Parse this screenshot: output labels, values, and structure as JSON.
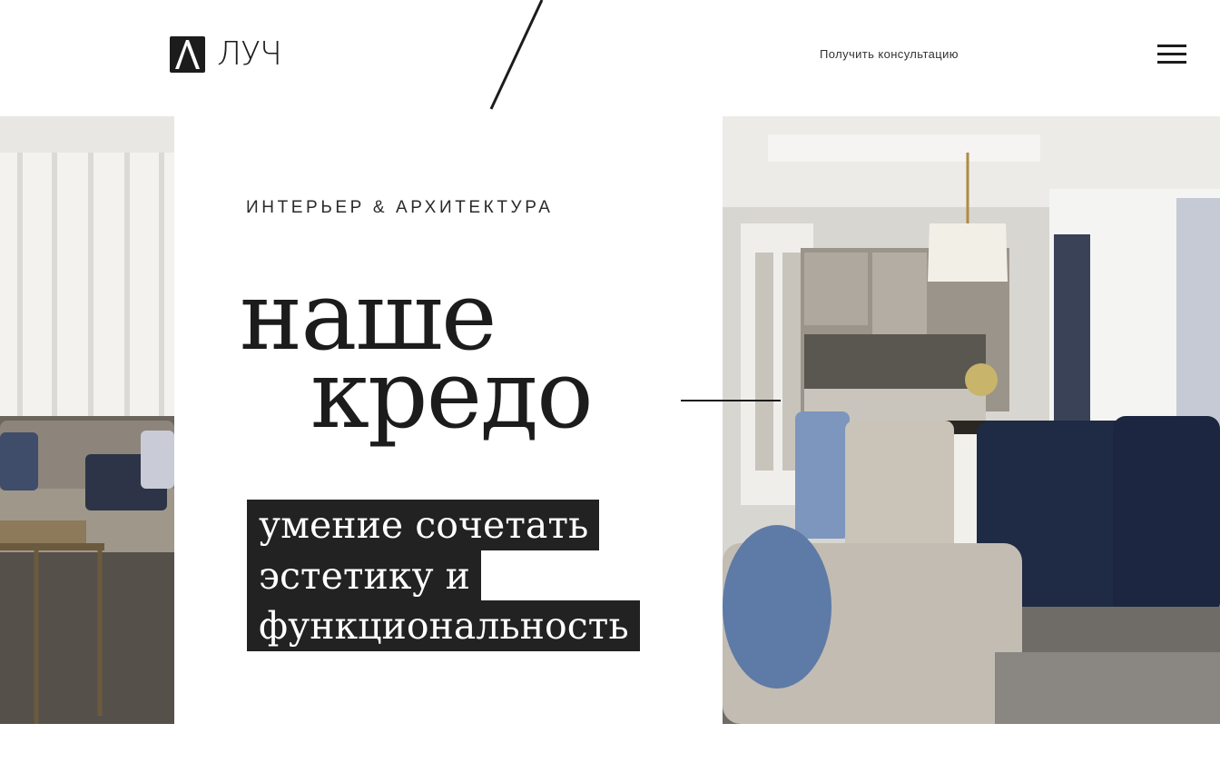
{
  "header": {
    "logo_text": "ЛУЧ",
    "consult_label": "Получить консультацию",
    "menu_icon": "hamburger-menu-icon"
  },
  "hero": {
    "eyebrow": "ИНТЕРЬЕР & АРХИТЕКТУРА",
    "headline_line1": "наше",
    "headline_line2": "кредо",
    "tagline_lines": [
      "умение сочетать",
      "эстетику и",
      "функциональность"
    ]
  },
  "images": {
    "left": "living-room-photo",
    "right": "dining-room-photo"
  },
  "colors": {
    "text": "#1c1c1c",
    "tag_background": "#222222",
    "tag_text": "#ffffff",
    "background": "#ffffff"
  }
}
